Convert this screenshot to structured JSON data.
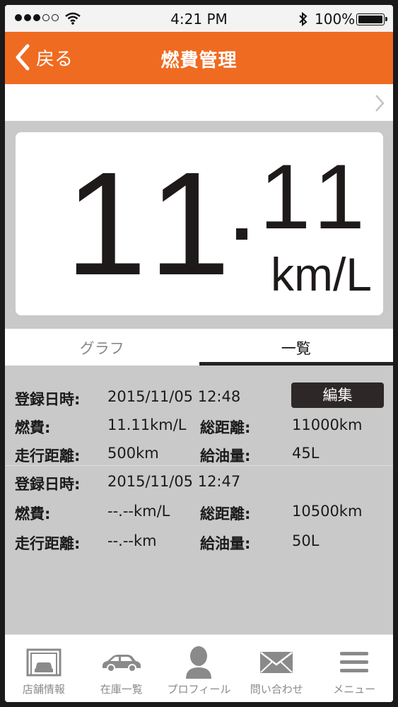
{
  "status_bar": {
    "time": "4:21 PM",
    "battery": "100%"
  },
  "nav": {
    "back_label": "戻る",
    "title": "燃費管理"
  },
  "fuel": {
    "integer": "11",
    "decimal": "11",
    "unit": "km/L"
  },
  "tabs": [
    {
      "label": "グラフ"
    },
    {
      "label": "一覧"
    }
  ],
  "records": [
    {
      "date_label": "登録日時:",
      "date": "2015/11/05 12:48",
      "edit_label": "編集",
      "fuel_label": "燃費:",
      "fuel": "11.11km/L",
      "total_label": "総距離:",
      "total": "11000km",
      "trip_label": "走行距離:",
      "trip": "500km",
      "refuel_label": "給油量:",
      "refuel": "45L"
    },
    {
      "date_label": "登録日時:",
      "date": "2015/11/05 12:47",
      "fuel_label": "燃費:",
      "fuel": "--.--km/L",
      "total_label": "総距離:",
      "total": "10500km",
      "trip_label": "走行距離:",
      "trip": "--.--km",
      "refuel_label": "給油量:",
      "refuel": "50L"
    }
  ],
  "tabbar": [
    {
      "label": "店舗情報",
      "icon": "garage-icon"
    },
    {
      "label": "在庫一覧",
      "icon": "car-icon"
    },
    {
      "label": "プロフィール",
      "icon": "person-icon"
    },
    {
      "label": "問い合わせ",
      "icon": "envelope-icon"
    },
    {
      "label": "メニュー",
      "icon": "hamburger-menu-icon"
    }
  ],
  "colors": {
    "accent": "#ef6b21",
    "background": "#c9c9c9",
    "edit_button": "#2d2727"
  }
}
